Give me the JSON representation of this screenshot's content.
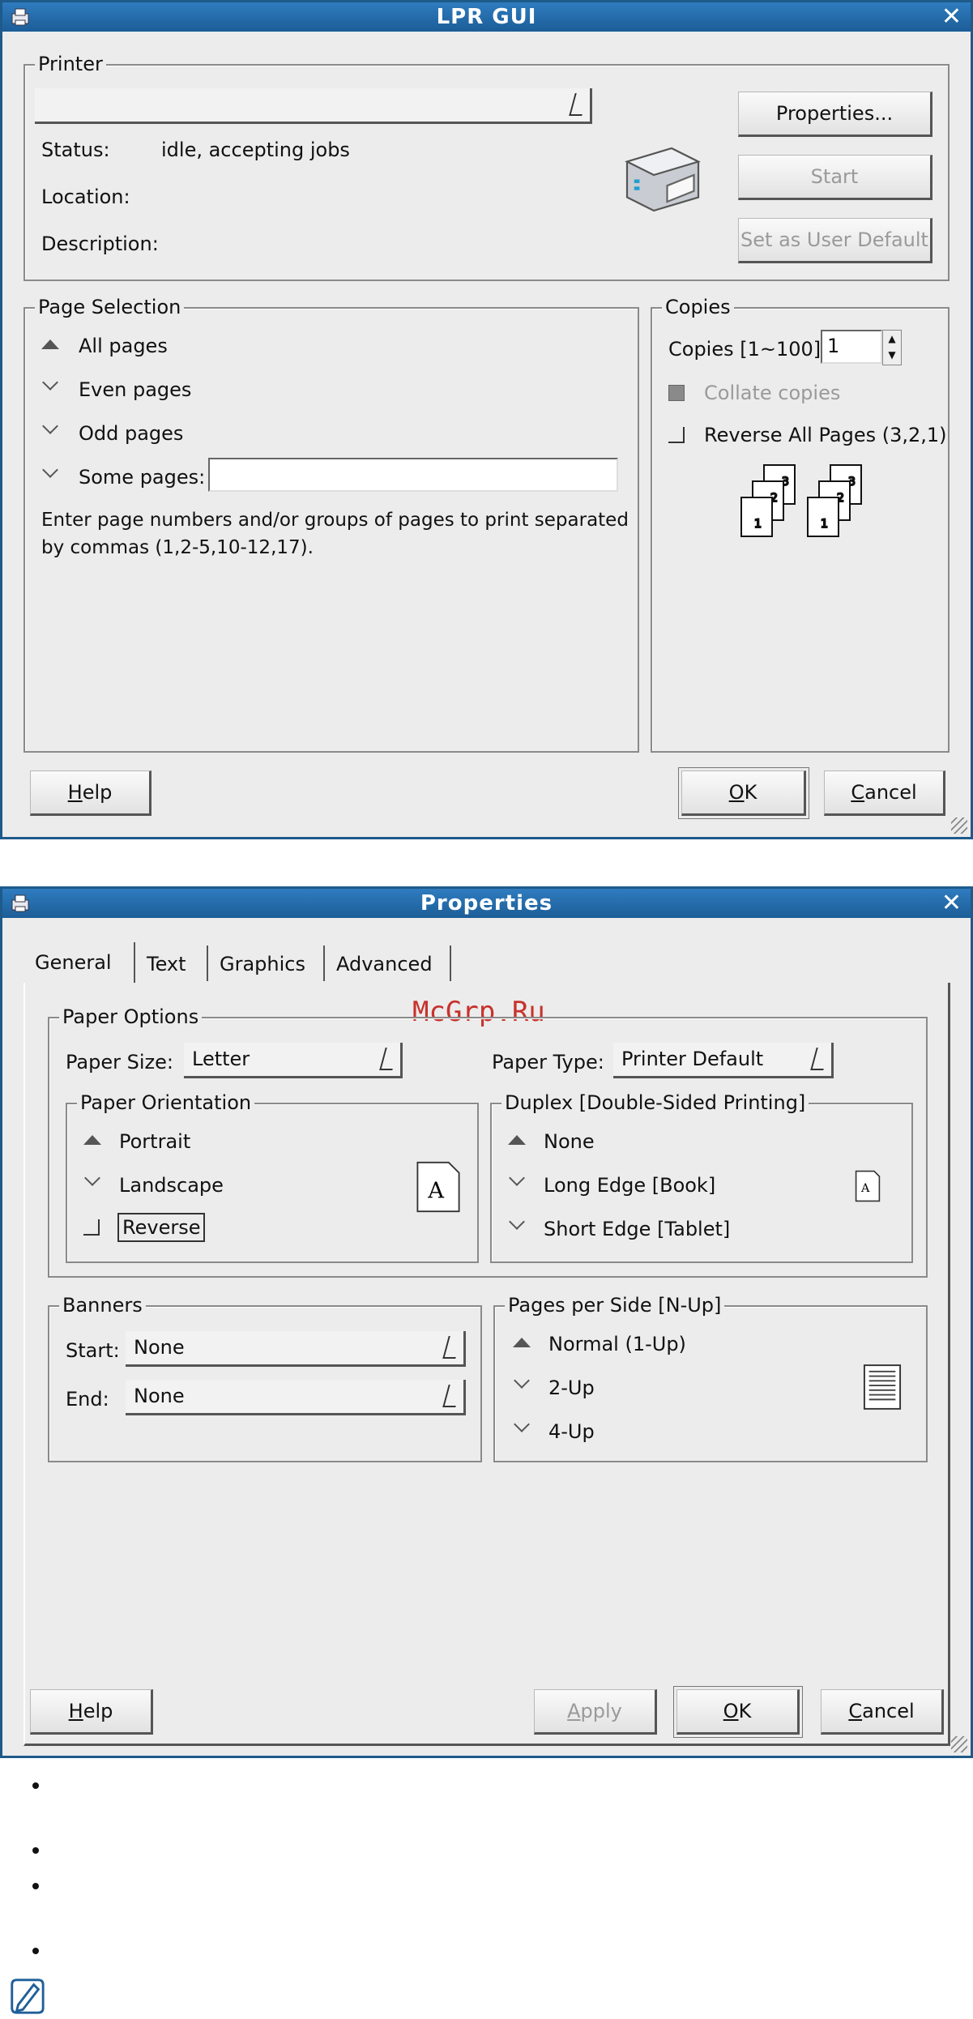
{
  "lpr": {
    "title": "LPR GUI",
    "printer_group": "Printer",
    "status_label": "Status:",
    "status_value": "idle, accepting jobs",
    "location_label": "Location:",
    "description_label": "Description:",
    "properties_btn": "Properties...",
    "start_btn": "Start",
    "user_default_btn": "Set as User Default",
    "page_selection_group": "Page Selection",
    "all_pages": "All pages",
    "even_pages": "Even pages",
    "odd_pages": "Odd pages",
    "some_pages": "Some pages:",
    "hint_line1": "Enter page numbers and/or groups of pages to print separated",
    "hint_line2": "by commas (1,2-5,10-12,17).",
    "copies_group": "Copies",
    "copies_label": "Copies [1~100]:",
    "copies_value": "1",
    "collate": "Collate copies",
    "reverse_all": "Reverse All Pages (3,2,1)",
    "help_btn_h": "H",
    "help_btn_rest": "elp",
    "ok_btn_o": "O",
    "ok_btn_rest": "K",
    "cancel_btn_c": "C",
    "cancel_btn_rest": "ancel"
  },
  "props": {
    "title": "Properties",
    "tabs": [
      "General",
      "Text",
      "Graphics",
      "Advanced"
    ],
    "watermark": "McGrp.Ru",
    "paper_options_group": "Paper Options",
    "paper_size_label": "Paper Size:",
    "paper_size_value": "Letter",
    "paper_type_label": "Paper Type:",
    "paper_type_value": "Printer Default",
    "orientation_group": "Paper Orientation",
    "portrait": "Portrait",
    "landscape": "Landscape",
    "reverse": "Reverse",
    "duplex_group": "Duplex [Double-Sided Printing]",
    "duplex_none": "None",
    "duplex_long": "Long Edge [Book]",
    "duplex_short": "Short Edge [Tablet]",
    "banners_group": "Banners",
    "start_label": "Start:",
    "start_value": "None",
    "end_label": "End:",
    "end_value": "None",
    "nup_group": "Pages per Side [N-Up]",
    "nup_normal": "Normal (1-Up)",
    "nup_2": "2-Up",
    "nup_4": "4-Up",
    "help_h": "H",
    "help_rest": "elp",
    "apply_a": "A",
    "apply_rest": "pply",
    "ok_o": "O",
    "ok_rest": "K",
    "cancel_c": "C",
    "cancel_rest": "ancel"
  },
  "page_icons": {
    "orientation_preview": "A",
    "duplex_preview": "A",
    "copies_sheet_numbers": [
      "1",
      "2",
      "3"
    ]
  },
  "icons": {
    "app_icon": "printer-icon",
    "close_icon": "close-icon",
    "note_icon": "note-pencil-icon"
  }
}
